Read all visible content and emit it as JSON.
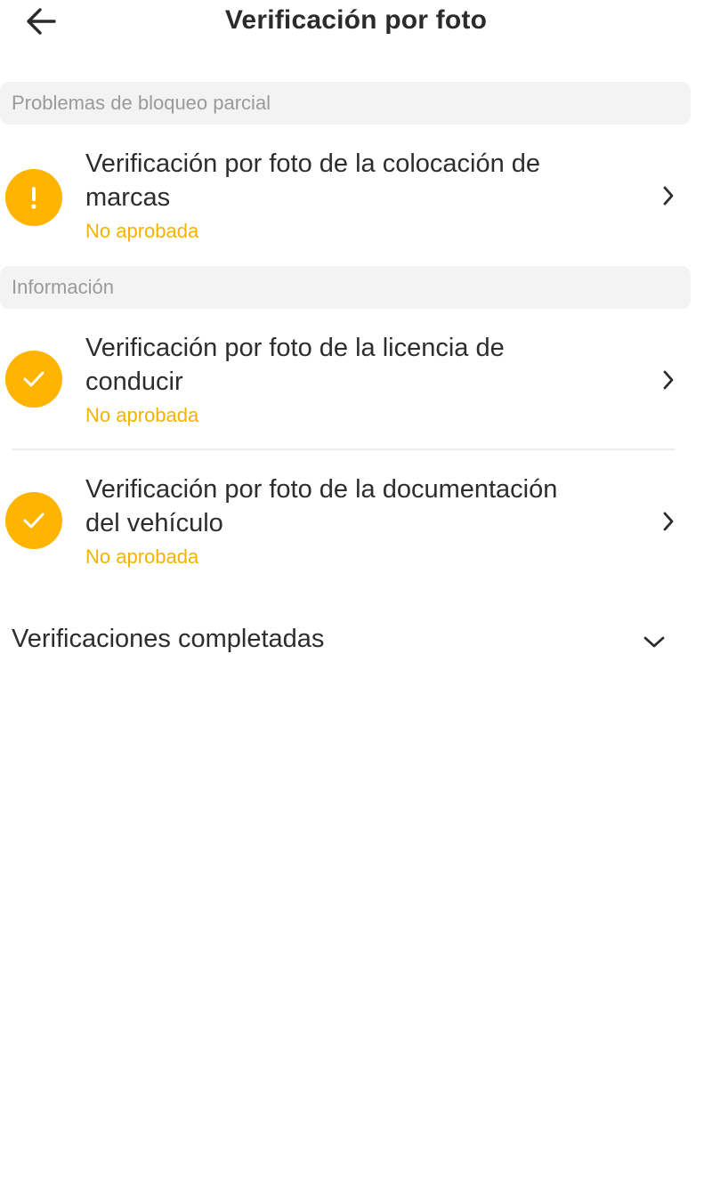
{
  "header": {
    "title": "Verificación por foto"
  },
  "sections": [
    {
      "label": "Problemas de bloqueo parcial",
      "items": [
        {
          "title_line1": "Verificación por foto de la colocación de",
          "title_line2": "marcas",
          "status": "No aprobada",
          "icon": "exclamation-icon"
        }
      ]
    },
    {
      "label": "Información",
      "items": [
        {
          "title_line1": "Verificación por foto de la licencia de",
          "title_line2": "conducir",
          "status": "No aprobada",
          "icon": "check-icon"
        },
        {
          "title_line1": "Verificación por foto de la documentación",
          "title_line2": "del vehículo",
          "status": "No aprobada",
          "icon": "check-icon"
        }
      ]
    }
  ],
  "completed": {
    "label": "Verificaciones completadas"
  },
  "colors": {
    "accent": "#ffb400",
    "status_text": "#f2b400",
    "section_bg": "#f3f3f3"
  }
}
